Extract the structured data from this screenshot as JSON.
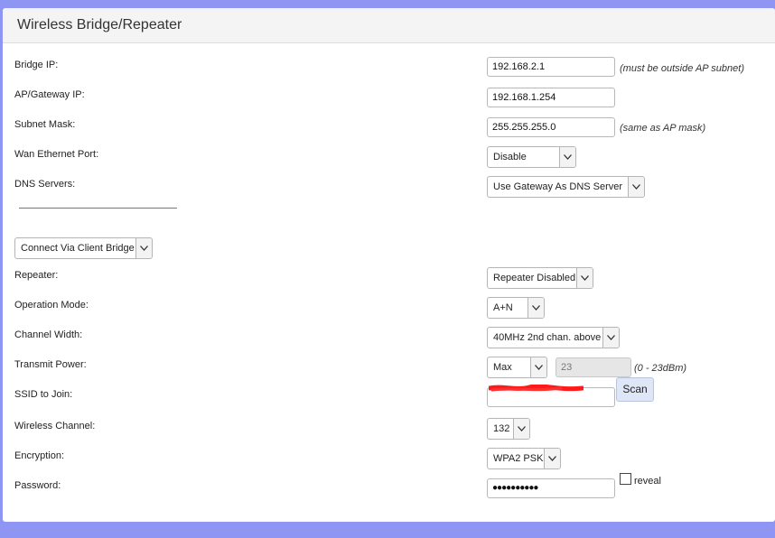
{
  "page": {
    "title": "Wireless Bridge/Repeater"
  },
  "fields": {
    "bridge_ip": {
      "label": "Bridge IP:",
      "value": "192.168.2.1",
      "hint": "(must be outside AP subnet)"
    },
    "gateway_ip": {
      "label": "AP/Gateway IP:",
      "value": "192.168.1.254"
    },
    "subnet_mask": {
      "label": "Subnet Mask:",
      "value": "255.255.255.0",
      "hint": "(same as AP mask)"
    },
    "wan_port": {
      "label": "Wan Ethernet Port:",
      "value": "Disable"
    },
    "dns_servers": {
      "label": "DNS Servers:",
      "value": "Use Gateway As DNS Server"
    },
    "mode_select": {
      "value": "Connect Via Client Bridge"
    },
    "repeater": {
      "label": "Repeater:",
      "value": "Repeater Disabled"
    },
    "operation_mode": {
      "label": "Operation Mode:",
      "value": "A+N"
    },
    "channel_width": {
      "label": "Channel Width:",
      "value": "40MHz 2nd chan. above"
    },
    "transmit_power": {
      "label": "Transmit Power:",
      "value": "Max",
      "level": "23",
      "hint": "(0 - 23dBm)"
    },
    "ssid": {
      "label": "SSID to Join:",
      "scan_label": "Scan"
    },
    "wireless_channel": {
      "label": "Wireless Channel:",
      "value": "132"
    },
    "encryption": {
      "label": "Encryption:",
      "value": "WPA2 PSK"
    },
    "password": {
      "label": "Password:",
      "value": "●●●●●●●●●●",
      "reveal_label": "reveal"
    }
  },
  "colors": {
    "background": "#8f95f2",
    "redaction": "#ff1a1a"
  }
}
